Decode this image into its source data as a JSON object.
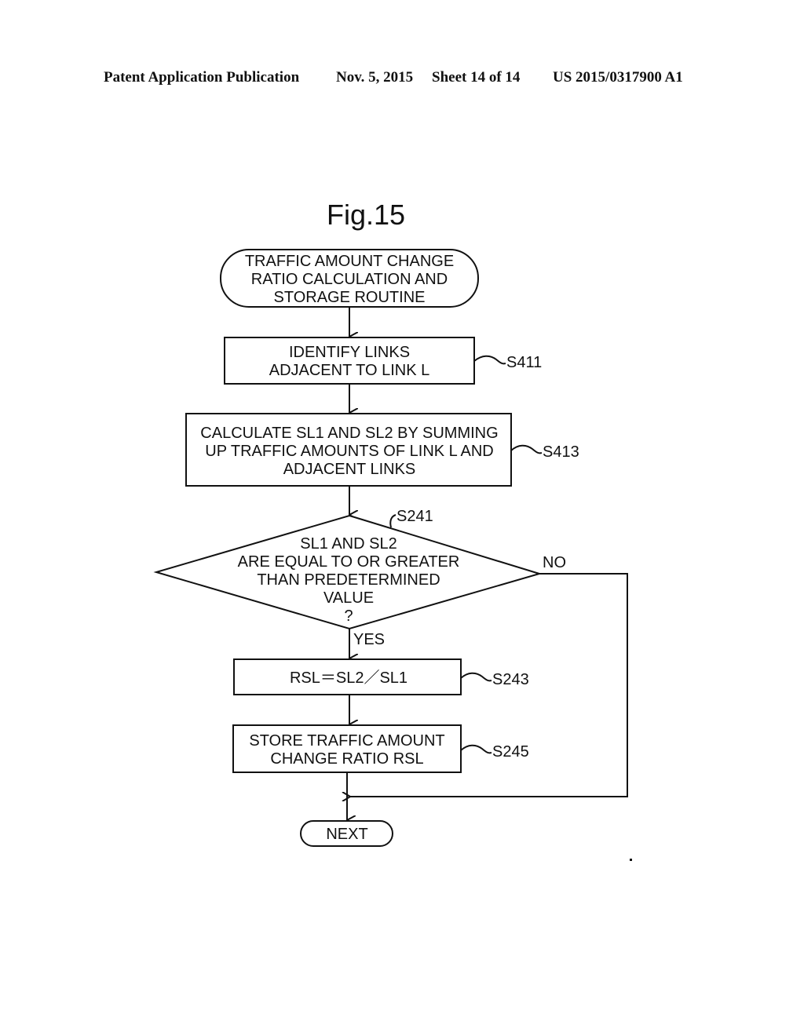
{
  "header": {
    "publication": "Patent Application Publication",
    "date": "Nov. 5, 2015",
    "sheet": "Sheet 14 of 14",
    "number": "US 2015/0317900 A1"
  },
  "figure": {
    "title": "Fig.15",
    "start": {
      "lines": [
        "TRAFFIC AMOUNT CHANGE",
        "RATIO CALCULATION AND",
        "STORAGE ROUTINE"
      ]
    },
    "steps": [
      {
        "id": "S411",
        "lines": [
          "IDENTIFY LINKS",
          "ADJACENT TO LINK L"
        ]
      },
      {
        "id": "S413",
        "lines": [
          "CALCULATE SL1 AND SL2 BY SUMMING",
          "UP TRAFFIC AMOUNTS OF LINK L AND",
          "ADJACENT LINKS"
        ]
      }
    ],
    "decision": {
      "id": "S241",
      "lines": [
        "SL1 AND SL2",
        "ARE EQUAL TO OR GREATER",
        "THAN PREDETERMINED",
        "VALUE",
        "?"
      ],
      "yes_label": "YES",
      "no_label": "NO"
    },
    "steps_after": [
      {
        "id": "S243",
        "lines": [
          "RSL＝SL2／SL1"
        ]
      },
      {
        "id": "S245",
        "lines": [
          "STORE TRAFFIC AMOUNT",
          "CHANGE RATIO RSL"
        ]
      }
    ],
    "end": {
      "label": "NEXT"
    }
  }
}
